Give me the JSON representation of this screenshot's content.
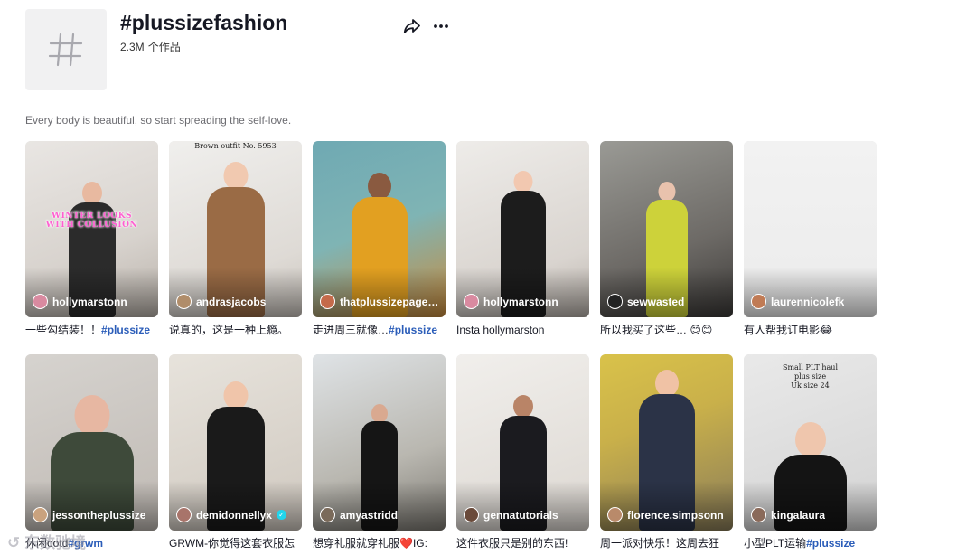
{
  "header": {
    "title": "#plussizefashion",
    "count_value": "2.3M",
    "count_unit": "个作品",
    "share_icon": "share-icon",
    "more_icon": "more-dots-icon"
  },
  "description": "Every body is beautiful, so start spreading the self-love.",
  "videos": [
    {
      "author": "hollymarstonn",
      "caption": "一些勾结装！！",
      "hashtag": "#plussize",
      "overlay": "WINTER LOOKS\nWITH COLLUSION",
      "avatar_color": "#d98aa0",
      "verified": false
    },
    {
      "author": "andrasjacobs",
      "caption": "说真的，这是一种上瘾。",
      "hashtag": "",
      "overlay": "Brown outfit No. 5953",
      "avatar_color": "#b08d6a",
      "verified": false
    },
    {
      "author": "thatplussizepage…",
      "caption": "走进周三就像…",
      "hashtag": "#plussize",
      "overlay": "",
      "avatar_color": "#c46a4a",
      "verified": false
    },
    {
      "author": "hollymarstonn",
      "caption": "Insta hollymarston",
      "hashtag": "",
      "overlay": "",
      "avatar_color": "#d98aa0",
      "verified": false
    },
    {
      "author": "sewwasted",
      "caption": "所以我买了这些… 😊😊",
      "hashtag": "",
      "overlay": "",
      "avatar_color": "#222222",
      "verified": false
    },
    {
      "author": "laurennicolefk",
      "caption": "有人帮我订电影😂",
      "hashtag": "",
      "overlay": "",
      "avatar_color": "#c07b55",
      "verified": false
    },
    {
      "author": "jessontheplussize",
      "caption": "休闲ootd",
      "hashtag": "#grwm",
      "overlay": "",
      "avatar_color": "#c9a27e",
      "verified": false
    },
    {
      "author": "demidonnellyx",
      "caption": "GRWM-你觉得这套衣服怎",
      "hashtag": "",
      "overlay": "",
      "avatar_color": "#a8746a",
      "verified": true
    },
    {
      "author": "amyastridd",
      "caption": "想穿礼服就穿礼服❤️IG:",
      "hashtag": "",
      "overlay": "",
      "avatar_color": "#7a6a5a",
      "verified": false
    },
    {
      "author": "gennatutorials",
      "caption": "这件衣服只是别的东西!",
      "hashtag": "",
      "overlay": "",
      "avatar_color": "#6a4a3a",
      "verified": false
    },
    {
      "author": "florence.simpsonn",
      "caption": "周一派对快乐！这周去狂",
      "hashtag": "",
      "overlay": "",
      "avatar_color": "#b98a6a",
      "verified": false
    },
    {
      "author": "kingalaura",
      "caption": "小型PLT运输",
      "hashtag": "#plussize",
      "overlay": "Small PLT haul\nplus size\nUk size 24",
      "avatar_color": "#8a6a5a",
      "verified": false
    }
  ],
  "watermark": "↺ 东数驰境"
}
